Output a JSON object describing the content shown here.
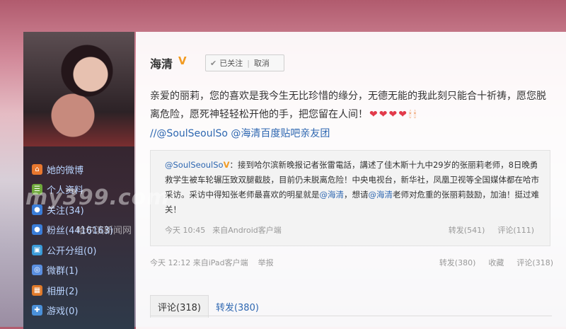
{
  "profile": {
    "nav": [
      {
        "label": "她的微博",
        "icon": "home-icon",
        "color": "#e8772e"
      },
      {
        "label": "个人资料",
        "icon": "profile-icon",
        "color": "#6fa83b"
      },
      {
        "label": "关注(34)",
        "icon": "follow-icon",
        "color": "#3a7dd8"
      },
      {
        "label": "粉丝(4416163)",
        "icon": "fans-icon",
        "color": "#3a7dd8"
      },
      {
        "label": "公开分组(0)",
        "icon": "group-icon",
        "color": "#3a9bd8"
      },
      {
        "label": "微群(1)",
        "icon": "weiqun-icon",
        "color": "#5a8fe0"
      },
      {
        "label": "相册(2)",
        "icon": "album-icon",
        "color": "#e07a2a"
      },
      {
        "label": "游戏(0)",
        "icon": "game-icon",
        "color": "#4a90d9"
      }
    ]
  },
  "post": {
    "author": "海清",
    "verified_badge": "V",
    "follow_status": "已关注",
    "cancel_follow": "取消",
    "text": "亲爱的丽莉，您的喜欢是我今生无比珍惜的缘分，无德无能的我此刻只能合十祈祷，愿您脱离危险，愿死神轻轻松开他的手，把您留在人间！",
    "mention1": "//@SoulSeoulSo",
    "mention2": "@海清百度贴吧亲友团",
    "time": "今天 12:12 来自",
    "source": "iPad客户端",
    "report": "举报",
    "forward": "转发(380)",
    "favorite": "收藏",
    "comment": "评论(318)"
  },
  "repost": {
    "author": "@SoulSeoulSo",
    "verified_badge": "V",
    "text_part1": "：接到哈尔滨新晚报记者张雷電話，講述了佳木斯十九中29岁的张丽莉老师，8日晚勇救学生被车轮辗压致双腿截肢，目前仍未脱离危险！中央电视台，新华社，凤凰卫视等全国媒体都在哈市采访。采访中得知张老师最喜欢的明星就是",
    "mention_haiqing": "@海清",
    "text_part2": "，想请",
    "mention_haiqing2": "@海清",
    "text_part3": "老师对危重的张丽莉鼓励，加油！挺过难关！",
    "time": "今天 10:45",
    "source": "来自Android客户端",
    "forward": "转发(541)",
    "comment": "评论(111)"
  },
  "tabs": {
    "comments": "评论(318)",
    "forwards": "转发(380)"
  },
  "watermark": {
    "text": "my399.com",
    "subtext": "哈尔滨新闻网"
  },
  "colors": {
    "link": "#2e67b1",
    "verified": "#f29b22",
    "heart": "#e23a4a"
  }
}
